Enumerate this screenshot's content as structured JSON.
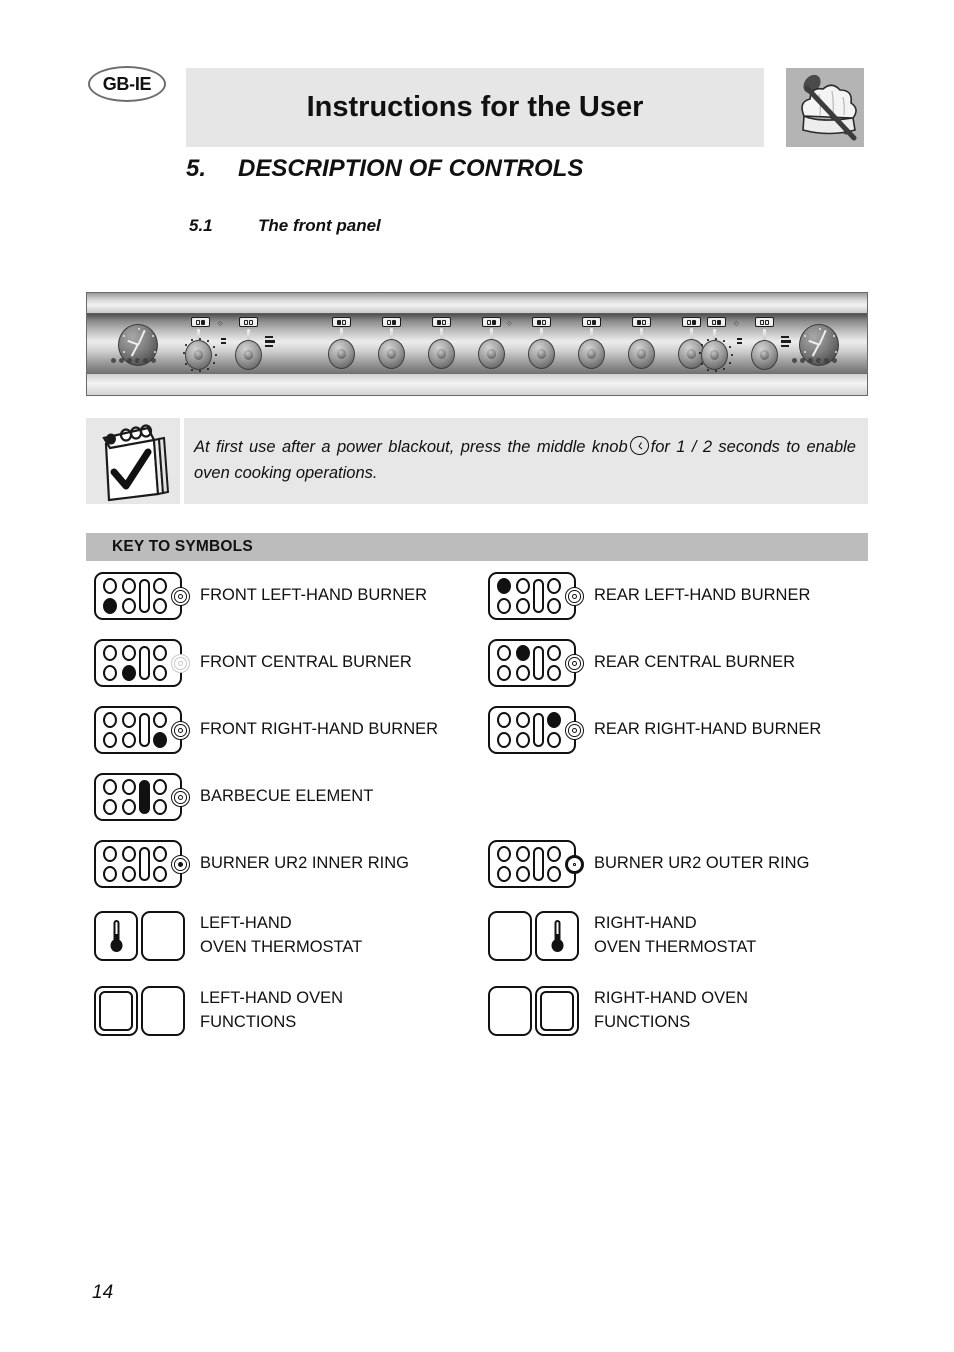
{
  "document": {
    "language_badge": "GB-IE",
    "header_title": "Instructions for the User",
    "page_number": "14",
    "logo_icon": "chef-hat-spoon-icon"
  },
  "section": {
    "number": "5.",
    "title": "DESCRIPTION OF CONTROLS",
    "subsection_number": "5.1",
    "subsection_title": "The front panel"
  },
  "note": {
    "icon": "notepad-checkmark-icon",
    "text_part1": "At first use after a power blackout, press the middle knob",
    "clock_icon": "clock-icon",
    "text_part2": "for 1 / 2 seconds to enable oven cooking operations."
  },
  "control_panel": {
    "caption": "front-panel-diagram",
    "left_timer_dial": "analogue-timer-dial",
    "right_timer_dial": "analogue-timer-dial",
    "left_oven_thermostat_knob": "left-oven-thermostat-knob",
    "left_oven_function_knob": "left-oven-function-knob",
    "right_oven_thermostat_knob": "right-oven-thermostat-knob",
    "right_oven_function_knob": "right-oven-function-knob",
    "hob_knob_count": 8
  },
  "key_to_symbols": {
    "header": "KEY TO SYMBOLS",
    "entries": [
      {
        "label": "FRONT LEFT-HAND BURNER",
        "glyph": "burner-symbol",
        "filled": "p3",
        "ring": "normal",
        "column": "left"
      },
      {
        "label": "REAR LEFT-HAND BURNER",
        "glyph": "burner-symbol",
        "filled": "p1",
        "ring": "normal",
        "column": "right"
      },
      {
        "label": "FRONT CENTRAL BURNER",
        "glyph": "burner-symbol",
        "filled": "p4",
        "ring": "faded",
        "column": "left"
      },
      {
        "label": "REAR CENTRAL BURNER",
        "glyph": "burner-symbol",
        "filled": "p2",
        "ring": "normal",
        "column": "right"
      },
      {
        "label": "FRONT RIGHT-HAND BURNER",
        "glyph": "burner-symbol",
        "filled": "p6",
        "ring": "normal",
        "column": "left"
      },
      {
        "label": "REAR RIGHT-HAND BURNER",
        "glyph": "burner-symbol",
        "filled": "p5",
        "ring": "normal",
        "column": "right"
      },
      {
        "label": "BARBECUE ELEMENT",
        "glyph": "burner-symbol",
        "filled": "bar",
        "ring": "normal",
        "column": "left"
      },
      {
        "label": "BURNER UR2 INNER RING",
        "glyph": "burner-symbol",
        "filled": "none",
        "ring": "inner-filled",
        "column": "left"
      },
      {
        "label": "BURNER UR2 OUTER RING",
        "glyph": "burner-symbol",
        "filled": "none",
        "ring": "outer-bold",
        "column": "right"
      },
      {
        "label": "LEFT-HAND\nOVEN THERMOSTAT",
        "glyph": "oven-pair-symbol",
        "thermostat_side": "left",
        "column": "left"
      },
      {
        "label": "RIGHT-HAND\nOVEN THERMOSTAT",
        "glyph": "oven-pair-symbol",
        "thermostat_side": "right",
        "column": "right"
      },
      {
        "label": "LEFT-HAND OVEN\nFUNCTIONS",
        "glyph": "oven-pair-symbol",
        "double_side": "left",
        "column": "left"
      },
      {
        "label": "RIGHT-HAND OVEN\nFUNCTIONS",
        "glyph": "oven-pair-symbol",
        "double_side": "right",
        "column": "right"
      }
    ]
  },
  "colors": {
    "header_band": "#e6e6e6",
    "key_header_band": "#bcbcbc",
    "note_band": "#e7e7e7",
    "logo_band": "#b4b4b4",
    "ink": "#111111"
  }
}
